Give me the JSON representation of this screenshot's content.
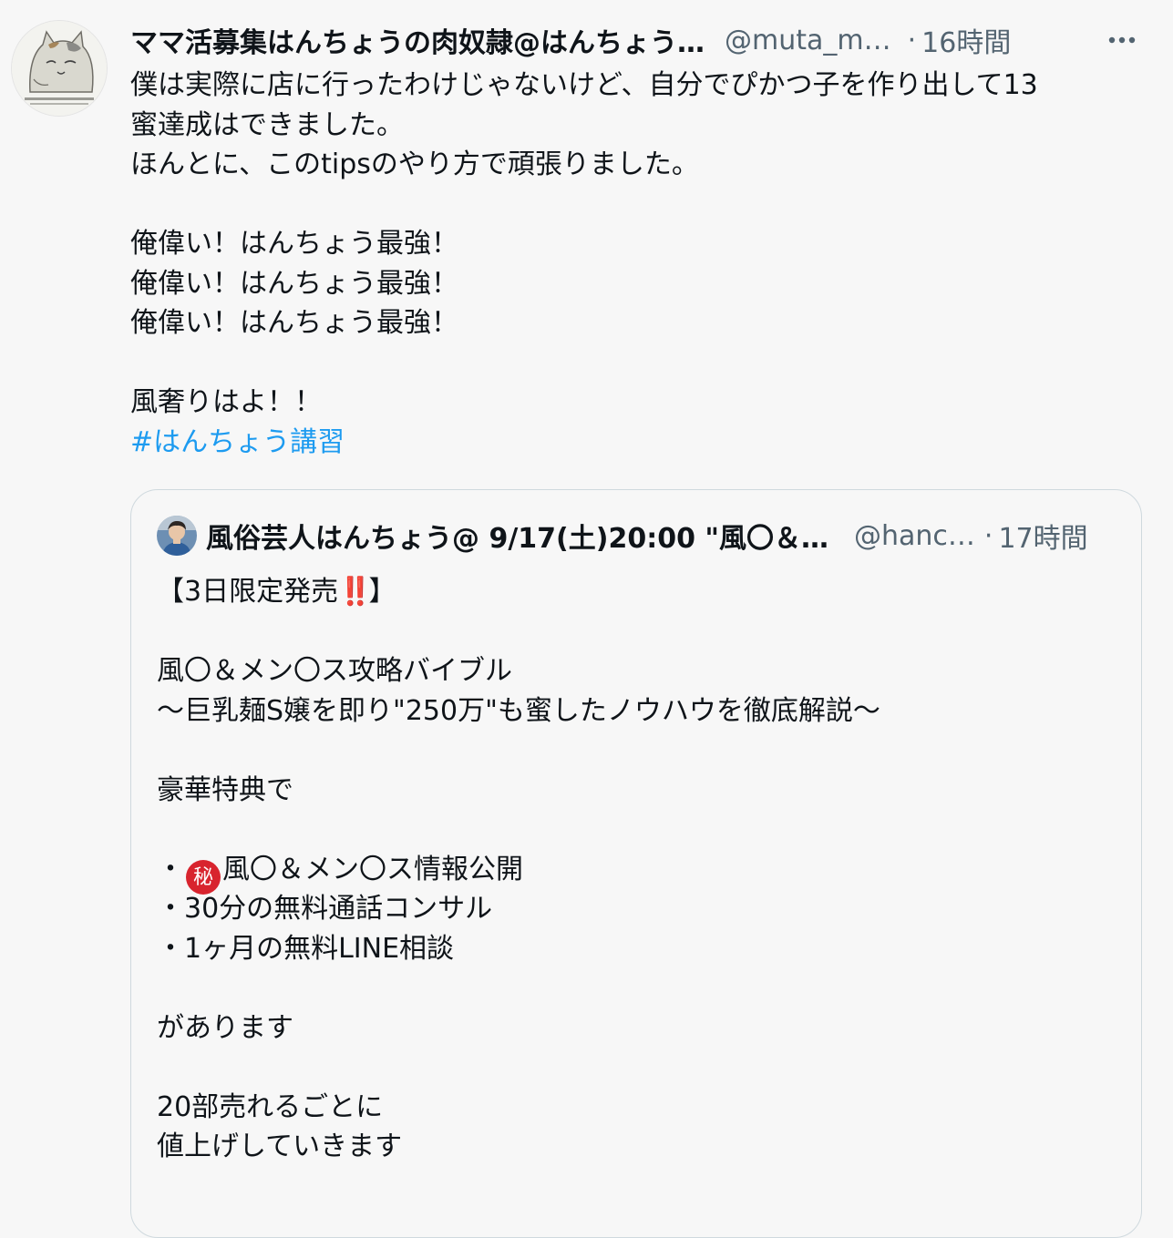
{
  "tweet": {
    "display_name": "ママ活募集はんちょうの肉奴隷@はんちょう…",
    "handle": "@muta_m…",
    "separator": "·",
    "time": "16時間",
    "more_icon": "more-horizontal-icon",
    "lines": [
      "僕は実際に店に行ったわけじゃないけど、自分でぴかつ子を作り出して13",
      "蜜達成はできました。",
      "ほんとに、このtipsのやり方で頑張りました。",
      "",
      "俺偉い！はんちょう最強！",
      "俺偉い！はんちょう最強！",
      "俺偉い！はんちょう最強！",
      "",
      "風奢りはよ！！"
    ],
    "hashtag": "#はんちょう講習"
  },
  "quote": {
    "display_name": "風俗芸人はんちょう@ 9/17(土)20:00 \"風〇＆…",
    "handle": "@hanc…",
    "separator": "·",
    "time": "17時間",
    "title_before": "【3日限定発売",
    "title_emoji": "‼️",
    "title_after": "】",
    "lines": [
      "",
      "風〇＆メン〇ス攻略バイブル",
      "〜巨乳麺S嬢を即り\"250万\"も蜜したノウハウを徹底解説〜",
      "",
      "豪華特典で",
      ""
    ],
    "bullet1_prefix": "・",
    "bullet1_badge": "秘",
    "bullet1_text": "風〇＆メン〇ス情報公開",
    "lines2": [
      "・30分の無料通話コンサル",
      "・1ヶ月の無料LINE相談",
      "",
      "があります",
      "",
      "20部売れるごとに",
      "値上げしていきます"
    ]
  },
  "colors": {
    "background": "#f7f7f7",
    "text": "#0f1419",
    "secondary": "#536471",
    "hashtag": "#1d9bf0",
    "border": "#cfd9de",
    "secret_badge": "#d8242e"
  }
}
